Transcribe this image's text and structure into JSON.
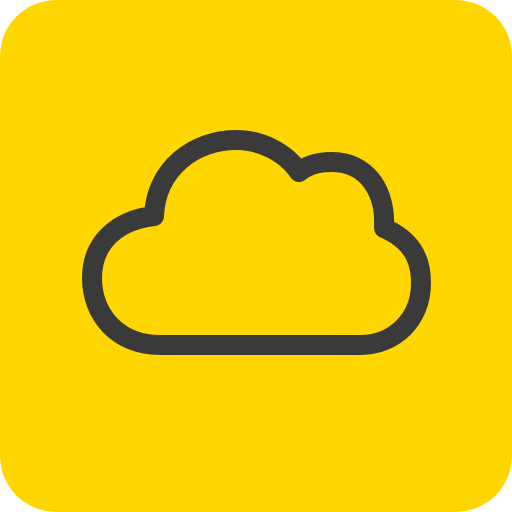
{
  "icon": {
    "name": "cloud-icon",
    "colors": {
      "background": "#FFD600",
      "stroke": "#3A3A3A"
    }
  }
}
